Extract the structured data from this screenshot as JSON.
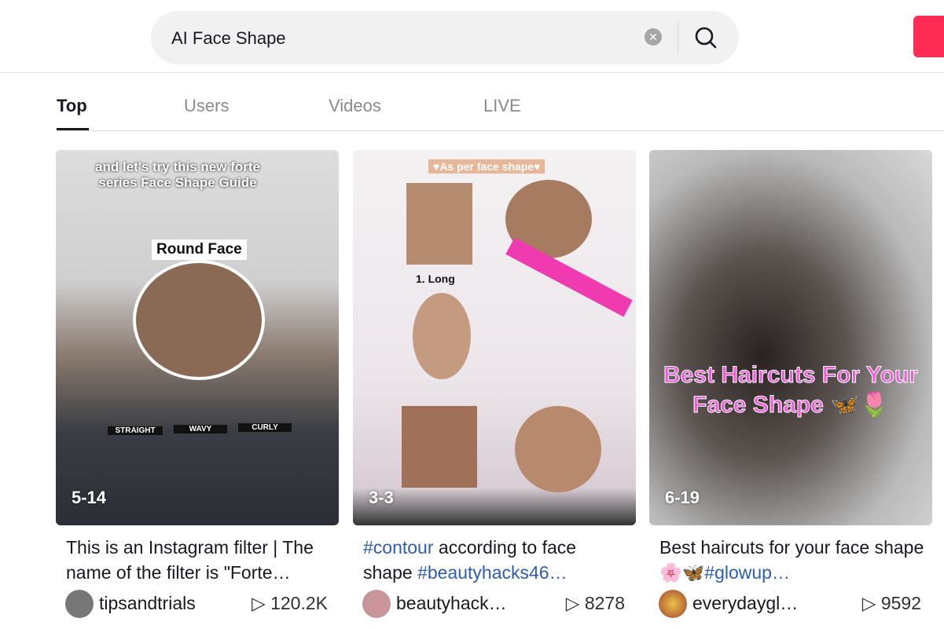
{
  "search": {
    "value": "AI Face Shape"
  },
  "tabs": [
    "Top",
    "Users",
    "Videos",
    "LIVE"
  ],
  "videos": [
    {
      "duration": "5-14",
      "caption": "This is an Instagram filter | The name of the filter is \"Forte…",
      "author": "tipsandtrials",
      "views": "120.2K",
      "overlay": [
        "and let's try this new forte series Face Shape Guide",
        "Round Face",
        "STRAIGHT",
        "WAVY",
        "CURLY"
      ]
    },
    {
      "duration": "3-3",
      "caption_parts": [
        "#contour",
        " according to face shape ",
        "#beautyhacks46…"
      ],
      "author": "beautyhack…",
      "views": "8278",
      "overlay": [
        "♥As per face shape♥",
        "1. Long"
      ]
    },
    {
      "duration": "6-19",
      "caption_parts": [
        "Best haircuts for your face shape 🌸🦋",
        "#glowup…"
      ],
      "author": "everydaygl…",
      "views": "9592",
      "overlay": [
        "Best Haircuts For Your Face Shape 🦋🌷"
      ]
    }
  ],
  "colors": {
    "accent": "#fe2c55",
    "hashtag": "#2b5db9"
  }
}
